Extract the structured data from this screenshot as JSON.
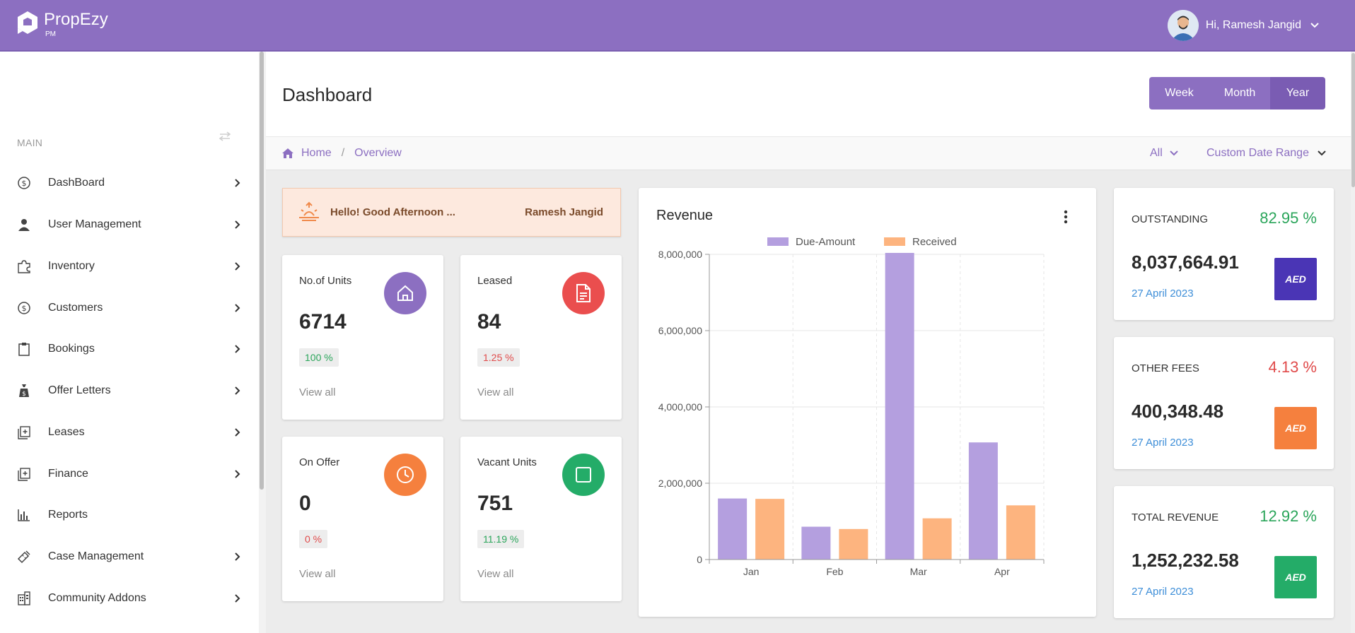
{
  "app": {
    "name": "PropEzy",
    "sub": "PM"
  },
  "user": {
    "greeting": "Hi, Ramesh Jangid"
  },
  "sidebar": {
    "section": "MAIN",
    "items": [
      {
        "label": "DashBoard",
        "icon": "dollar-circle-icon",
        "has_arrow": true
      },
      {
        "label": "User Management",
        "icon": "user-icon",
        "has_arrow": true
      },
      {
        "label": "Inventory",
        "icon": "puzzle-icon",
        "has_arrow": true
      },
      {
        "label": "Customers",
        "icon": "dollar-circle-icon",
        "has_arrow": true
      },
      {
        "label": "Bookings",
        "icon": "clipboard-icon",
        "has_arrow": true
      },
      {
        "label": "Offer Letters",
        "icon": "money-bag-icon",
        "has_arrow": true
      },
      {
        "label": "Leases",
        "icon": "stack-plus-icon",
        "has_arrow": true
      },
      {
        "label": "Finance",
        "icon": "stack-plus-icon",
        "has_arrow": true
      },
      {
        "label": "Reports",
        "icon": "bar-chart-icon",
        "has_arrow": false
      },
      {
        "label": "Case Management",
        "icon": "ticket-icon",
        "has_arrow": true
      },
      {
        "label": "Community Addons",
        "icon": "building-icon",
        "has_arrow": true
      }
    ]
  },
  "header": {
    "title": "Dashboard",
    "ranges": [
      "Week",
      "Month",
      "Year"
    ],
    "active_range": "Year"
  },
  "breadcrumb": {
    "home": "Home",
    "current": "Overview"
  },
  "filters": {
    "all": "All",
    "date": "Custom Date Range"
  },
  "banner": {
    "text": "Hello! Good Afternoon ...",
    "name": "Ramesh Jangid"
  },
  "stats": [
    {
      "label": "No.of Units",
      "value": "6714",
      "badge": "100 %",
      "badge_color": "#2aa55a",
      "link": "View all",
      "icon": "home-icon",
      "circle_color": "#8c6fc1"
    },
    {
      "label": "Leased",
      "value": "84",
      "badge": "1.25 %",
      "badge_color": "#e04a4a",
      "link": "View all",
      "icon": "document-icon",
      "circle_color": "#ea4e4e"
    },
    {
      "label": "On Offer",
      "value": "0",
      "badge": "0 %",
      "badge_color": "#e04a4a",
      "link": "View all",
      "icon": "clock-icon",
      "circle_color": "#f5803e"
    },
    {
      "label": "Vacant Units",
      "value": "751",
      "badge": "11.19 %",
      "badge_color": "#2aa55a",
      "link": "View all",
      "icon": "square-icon",
      "circle_color": "#24ac68"
    }
  ],
  "revenue": {
    "title": "Revenue"
  },
  "chart_data": {
    "type": "bar",
    "title": "Revenue",
    "categories": [
      "Jan",
      "Feb",
      "Mar",
      "Apr"
    ],
    "series": [
      {
        "name": "Due-Amount",
        "color": "#b49fdf",
        "values": [
          1600000,
          860000,
          8037665,
          3070000
        ]
      },
      {
        "name": "Received",
        "color": "#fdb47f",
        "values": [
          1590000,
          800000,
          1080000,
          1420000
        ]
      }
    ],
    "ylim": [
      0,
      8000000
    ],
    "yticks": [
      "0",
      "2,000,000",
      "4,000,000",
      "6,000,000",
      "8,000,000"
    ],
    "ytick_values": [
      0,
      2000000,
      4000000,
      6000000,
      8000000
    ],
    "legend": "top",
    "grid": true
  },
  "summaries": [
    {
      "label": "OUTSTANDING",
      "pct": "82.95 %",
      "pct_color": "#2aa55a",
      "amount": "8,037,664.91",
      "date": "27 April 2023",
      "badge": "AED",
      "badge_color": "#4a35b5"
    },
    {
      "label": "OTHER FEES",
      "pct": "4.13 %",
      "pct_color": "#e04a4a",
      "amount": "400,348.48",
      "date": "27 April 2023",
      "badge": "AED",
      "badge_color": "#f5803e"
    },
    {
      "label": "TOTAL REVENUE",
      "pct": "12.92 %",
      "pct_color": "#2aa55a",
      "amount": "1,252,232.58",
      "date": "27 April 2023",
      "badge": "AED",
      "badge_color": "#24ac68"
    }
  ]
}
